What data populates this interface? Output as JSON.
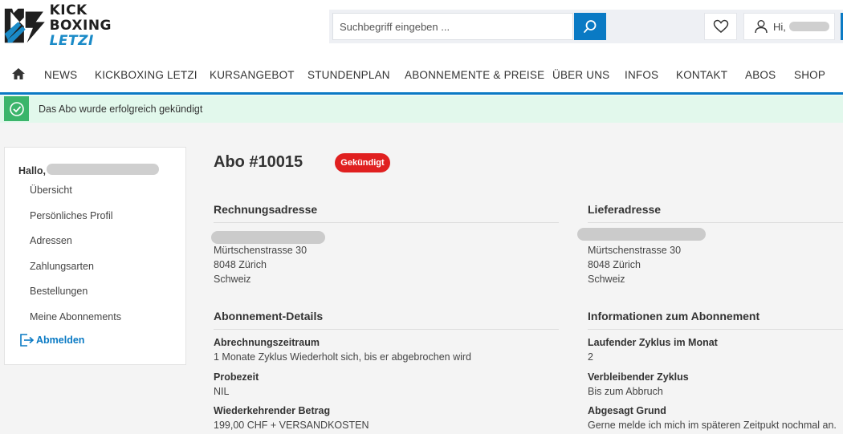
{
  "logo": {
    "line1": "KICK",
    "line2": "BOXING",
    "line3": "LETZI"
  },
  "search": {
    "placeholder": "Suchbegriff eingeben ..."
  },
  "account": {
    "greeting": "Hi,"
  },
  "nav": [
    "NEWS",
    "KICKBOXING LETZI",
    "KURSANGEBOT",
    "STUNDENPLAN",
    "ABONNEMENTE & PREISE",
    "ÜBER UNS",
    "INFOS",
    "KONTAKT",
    "ABOS",
    "SHOP"
  ],
  "alert": {
    "message": "Das Abo wurde erfolgreich gekündigt"
  },
  "sidebar": {
    "hello": "Hallo,",
    "items": [
      "Übersicht",
      "Persönliches Profil",
      "Adressen",
      "Zahlungsarten",
      "Bestellungen",
      "Meine Abonnements"
    ],
    "logout": "Abmelden"
  },
  "subscription": {
    "title": "Abo #10015",
    "status": "Gekündigt"
  },
  "billing": {
    "heading": "Rechnungsadresse",
    "street": "Mürtschenstrasse 30",
    "city": "8048 Zürich",
    "country": "Schweiz"
  },
  "shipping": {
    "heading": "Lieferadresse",
    "street": "Mürtschenstrasse 30",
    "city": "8048 Zürich",
    "country": "Schweiz"
  },
  "details": {
    "heading": "Abonnement-Details",
    "fields": [
      {
        "label": "Abrechnungszeitraum",
        "value": "1 Monate Zyklus Wiederholt sich, bis er abgebrochen wird"
      },
      {
        "label": "Probezeit",
        "value": "NIL"
      },
      {
        "label": "Wiederkehrender Betrag",
        "value": "199,00 CHF + VERSANDKOSTEN"
      }
    ]
  },
  "info": {
    "heading": "Informationen zum Abonnement",
    "fields": [
      {
        "label": "Laufender Zyklus im Monat",
        "value": "2"
      },
      {
        "label": "Verbleibender Zyklus",
        "value": "Bis zum Abbruch"
      },
      {
        "label": "Abgesagt Grund",
        "value": "Gerne melde ich mich im späteren Zeitpukt nochmal an."
      }
    ]
  },
  "colors": {
    "accent": "#0a7ac4",
    "success": "#3bb56b",
    "danger": "#e02020"
  }
}
